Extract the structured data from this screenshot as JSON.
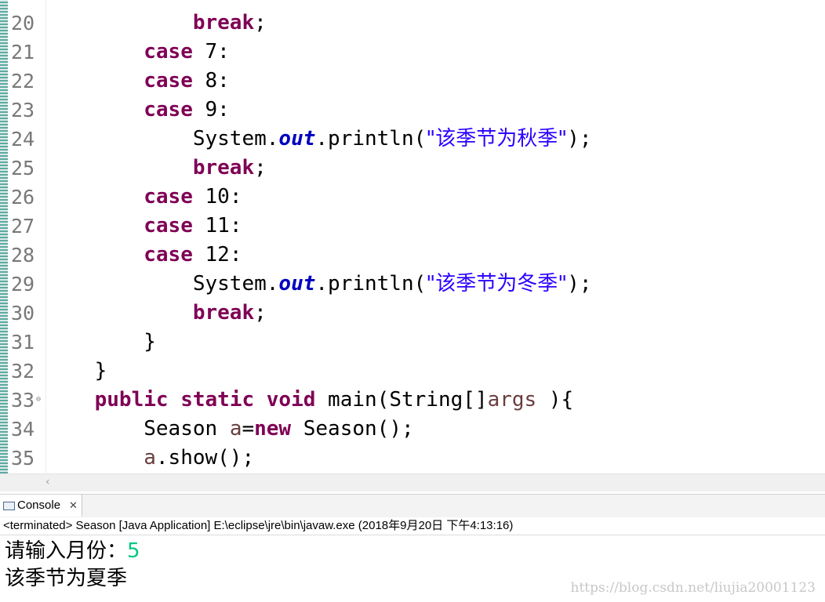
{
  "editor": {
    "lines": [
      {
        "n": "20",
        "indent": "            ",
        "parts": [
          {
            "t": "break",
            "c": "kw"
          },
          {
            "t": ";"
          }
        ]
      },
      {
        "n": "21",
        "indent": "        ",
        "parts": [
          {
            "t": "case",
            "c": "kw"
          },
          {
            "t": " 7:"
          }
        ]
      },
      {
        "n": "22",
        "indent": "        ",
        "parts": [
          {
            "t": "case",
            "c": "kw"
          },
          {
            "t": " 8:"
          }
        ]
      },
      {
        "n": "23",
        "indent": "        ",
        "parts": [
          {
            "t": "case",
            "c": "kw"
          },
          {
            "t": " 9:"
          }
        ]
      },
      {
        "n": "24",
        "indent": "            ",
        "parts": [
          {
            "t": "System."
          },
          {
            "t": "out",
            "c": "fld"
          },
          {
            "t": ".println("
          },
          {
            "t": "\"该季节为秋季\"",
            "c": "str"
          },
          {
            "t": ");"
          }
        ]
      },
      {
        "n": "25",
        "indent": "            ",
        "parts": [
          {
            "t": "break",
            "c": "kw"
          },
          {
            "t": ";"
          }
        ]
      },
      {
        "n": "26",
        "indent": "        ",
        "parts": [
          {
            "t": "case",
            "c": "kw"
          },
          {
            "t": " 10:"
          }
        ]
      },
      {
        "n": "27",
        "indent": "        ",
        "parts": [
          {
            "t": "case",
            "c": "kw"
          },
          {
            "t": " 11:"
          }
        ]
      },
      {
        "n": "28",
        "indent": "        ",
        "parts": [
          {
            "t": "case",
            "c": "kw"
          },
          {
            "t": " 12:"
          }
        ]
      },
      {
        "n": "29",
        "indent": "            ",
        "parts": [
          {
            "t": "System."
          },
          {
            "t": "out",
            "c": "fld"
          },
          {
            "t": ".println("
          },
          {
            "t": "\"该季节为冬季\"",
            "c": "str"
          },
          {
            "t": ");"
          }
        ]
      },
      {
        "n": "30",
        "indent": "            ",
        "parts": [
          {
            "t": "break",
            "c": "kw"
          },
          {
            "t": ";"
          }
        ]
      },
      {
        "n": "31",
        "indent": "        ",
        "parts": [
          {
            "t": "}"
          }
        ]
      },
      {
        "n": "32",
        "indent": "    ",
        "parts": [
          {
            "t": "}"
          }
        ]
      },
      {
        "n": "33",
        "indent": "    ",
        "fold": true,
        "parts": [
          {
            "t": "public",
            "c": "kw"
          },
          {
            "t": " "
          },
          {
            "t": "static",
            "c": "kw"
          },
          {
            "t": " "
          },
          {
            "t": "void",
            "c": "kw"
          },
          {
            "t": " main(String[]"
          },
          {
            "t": "args",
            "c": "var"
          },
          {
            "t": " ){"
          }
        ]
      },
      {
        "n": "34",
        "indent": "        ",
        "parts": [
          {
            "t": "Season "
          },
          {
            "t": "a",
            "c": "var"
          },
          {
            "t": "="
          },
          {
            "t": "new",
            "c": "kw"
          },
          {
            "t": " Season();"
          }
        ]
      },
      {
        "n": "35",
        "indent": "        ",
        "parts": [
          {
            "t": "a",
            "c": "var"
          },
          {
            "t": ".show();"
          }
        ]
      }
    ]
  },
  "scrollbar": {
    "left_arrow": "‹"
  },
  "console": {
    "tab_label": "Console",
    "tab_close": "✕",
    "status": "<terminated> Season [Java Application] E:\\eclipse\\jre\\bin\\javaw.exe (2018年9月20日 下午4:13:16)",
    "prompt": "请输入月份：",
    "input_value": "5",
    "result": "该季节为夏季"
  },
  "watermark": "https://blog.csdn.net/liujia20001123"
}
